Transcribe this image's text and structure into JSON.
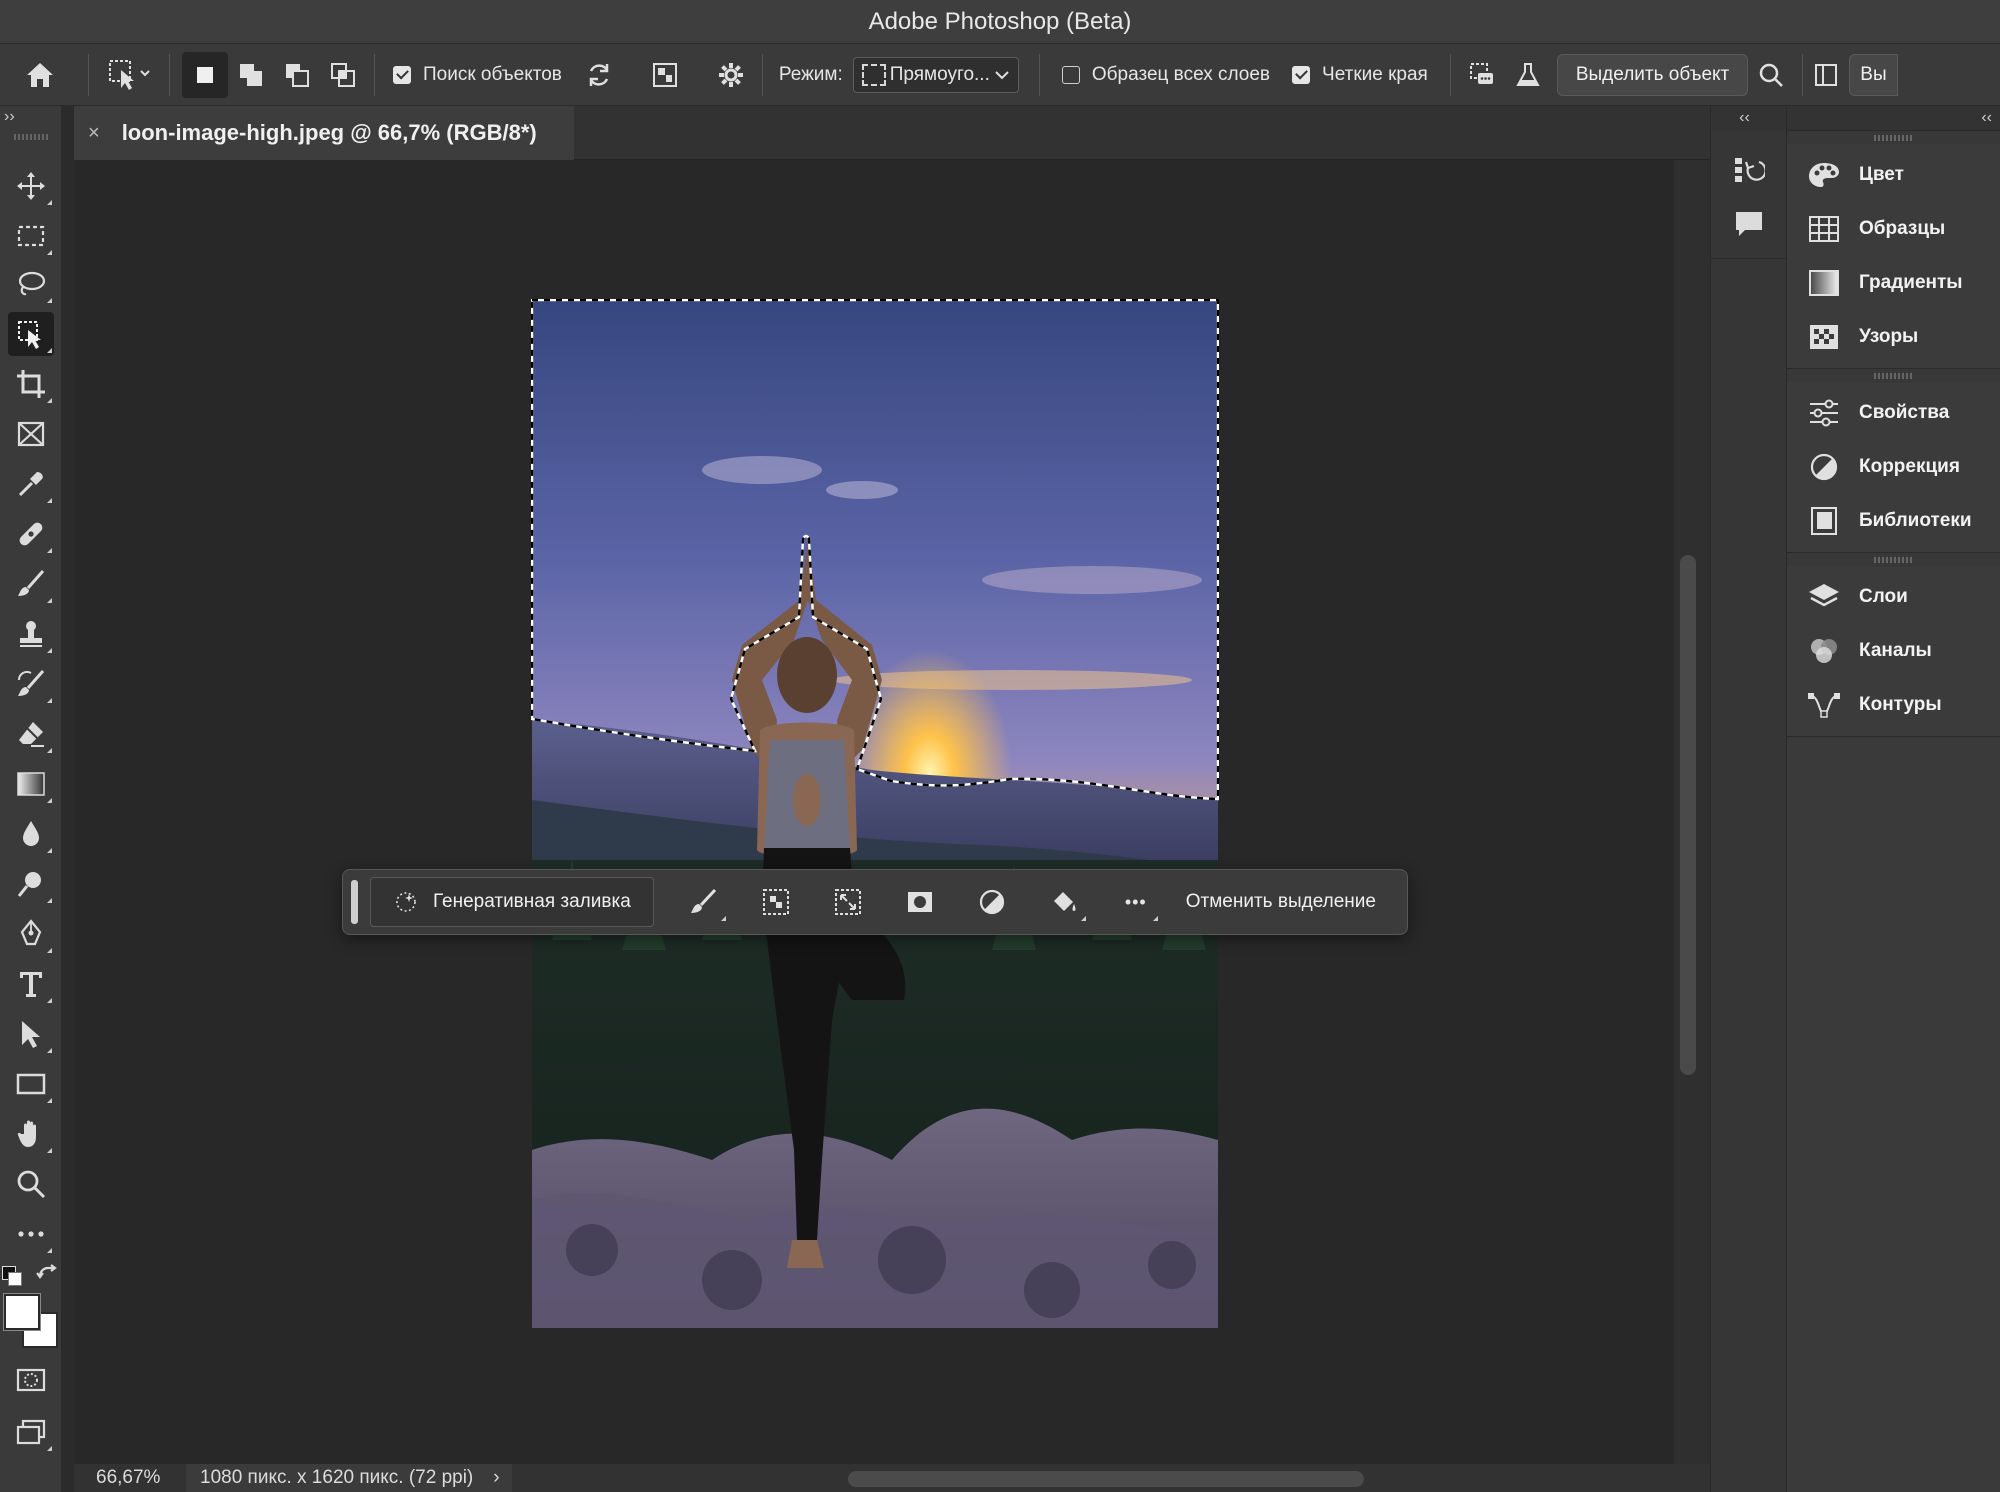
{
  "app": {
    "title": "Adobe Photoshop (Beta)"
  },
  "options_bar": {
    "subject_search_label": "Поиск объектов",
    "mode_label": "Режим:",
    "mode_value": "Прямоуго...",
    "sample_all_layers_label": "Образец всех слоев",
    "sample_all_layers_checked": false,
    "hard_edge_label": "Четкие края",
    "hard_edge_checked": true,
    "subject_search_checked": true,
    "select_subject_label": "Выделить объект",
    "truncated_label": "Вы"
  },
  "document": {
    "tab_title": "loon-image-high.jpeg @ 66,7% (RGB/8*)",
    "close_glyph": "×"
  },
  "contextual_taskbar": {
    "generative_fill_label": "Генеративная заливка",
    "deselect_label": "Отменить выделение",
    "more_glyph": "•••"
  },
  "status_bar": {
    "zoom": "66,67%",
    "doc_info": "1080 пикс. x 1620 пикс. (72 ppi)",
    "arrow": "›"
  },
  "panels": {
    "collapse_glyph": "‹‹",
    "expand_glyph": "››",
    "items": [
      {
        "label": "Цвет",
        "icon": "palette-icon"
      },
      {
        "label": "Образцы",
        "icon": "swatches-icon"
      },
      {
        "label": "Градиенты",
        "icon": "gradient-icon"
      },
      {
        "label": "Узоры",
        "icon": "patterns-icon"
      },
      {
        "label": "Свойства",
        "icon": "properties-icon"
      },
      {
        "label": "Коррекция",
        "icon": "adjustments-icon"
      },
      {
        "label": "Библиотеки",
        "icon": "libraries-icon"
      },
      {
        "label": "Слои",
        "icon": "layers-icon"
      },
      {
        "label": "Каналы",
        "icon": "channels-icon"
      },
      {
        "label": "Контуры",
        "icon": "paths-icon"
      }
    ]
  },
  "colors": {
    "ui_bg": "#3a3a3a",
    "canvas_bg": "#282828",
    "text": "#e6e6e6"
  }
}
